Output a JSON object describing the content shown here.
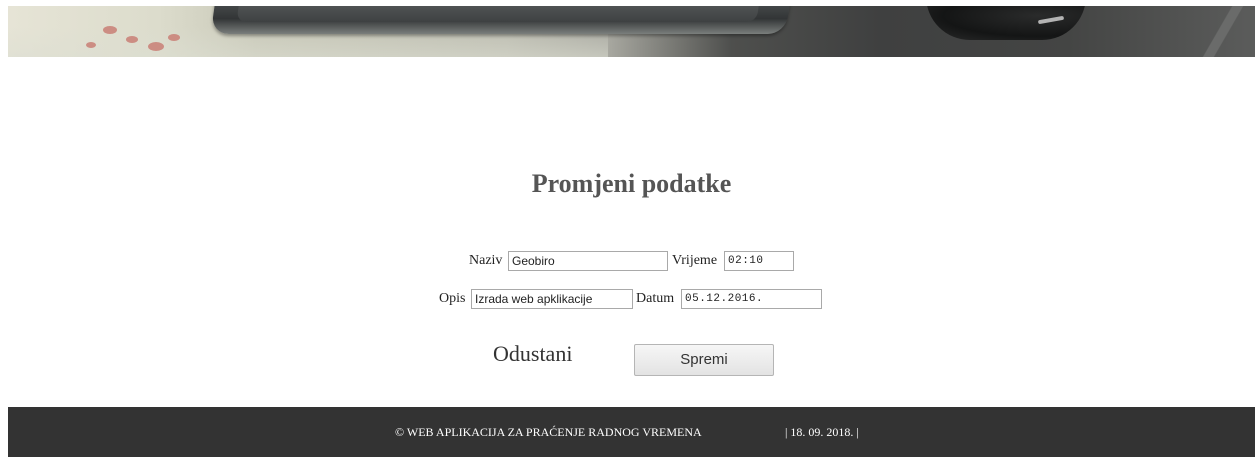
{
  "form": {
    "title": "Promjeni podatke",
    "naziv_label": "Naziv",
    "naziv_value": "Geobiro",
    "vrijeme_label": "Vrijeme",
    "vrijeme_value": "02:10",
    "opis_label": "Opis",
    "opis_value": "Izrada web apklikacije",
    "datum_label": "Datum",
    "datum_value": "05.12.2016."
  },
  "actions": {
    "cancel_label": "Odustani",
    "save_label": "Spremi"
  },
  "footer": {
    "copyright": "© WEB APLIKACIJA ZA PRAĆENJE RADNOG VREMENA",
    "date": "| 18. 09. 2018. |"
  }
}
